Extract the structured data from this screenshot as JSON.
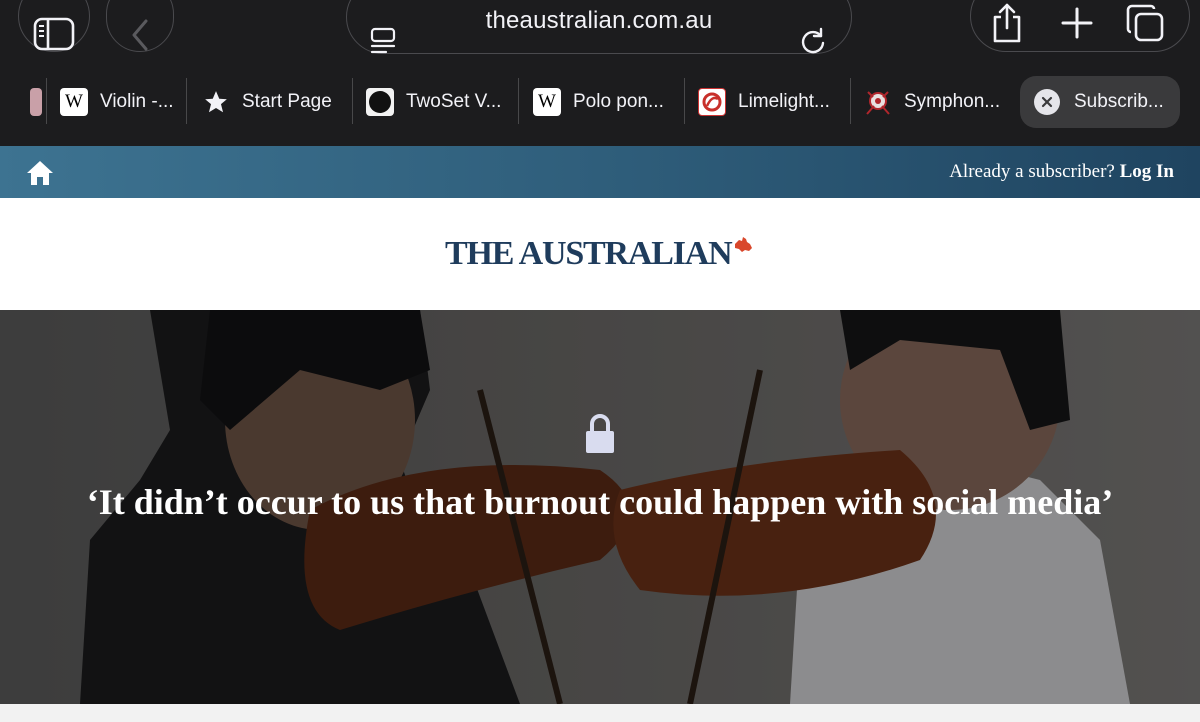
{
  "browser": {
    "url": "theaustralian.com.au",
    "tabs": [
      {
        "label": "Violin -...",
        "icon": "wikipedia-icon"
      },
      {
        "label": "Start Page",
        "icon": "star-icon"
      },
      {
        "label": "TwoSet V...",
        "icon": "twoset-icon"
      },
      {
        "label": "Polo pon...",
        "icon": "wikipedia-icon"
      },
      {
        "label": "Limelight...",
        "icon": "limelight-icon"
      },
      {
        "label": "Symphon...",
        "icon": "symphony-icon"
      },
      {
        "label": "Subscrib...",
        "icon": "close-icon",
        "active": true
      }
    ]
  },
  "page": {
    "subscriber_prompt": "Already a subscriber?",
    "login_label": "Log In",
    "logo": "THE AUSTRALIAN",
    "headline": "‘It didn’t occur to us that burnout could happen with social media’",
    "colors": {
      "masthead_blue": "#1f3c5c",
      "accent_red": "#d9472b",
      "bar_start": "#3d7391",
      "bar_end": "#1f4460"
    }
  }
}
